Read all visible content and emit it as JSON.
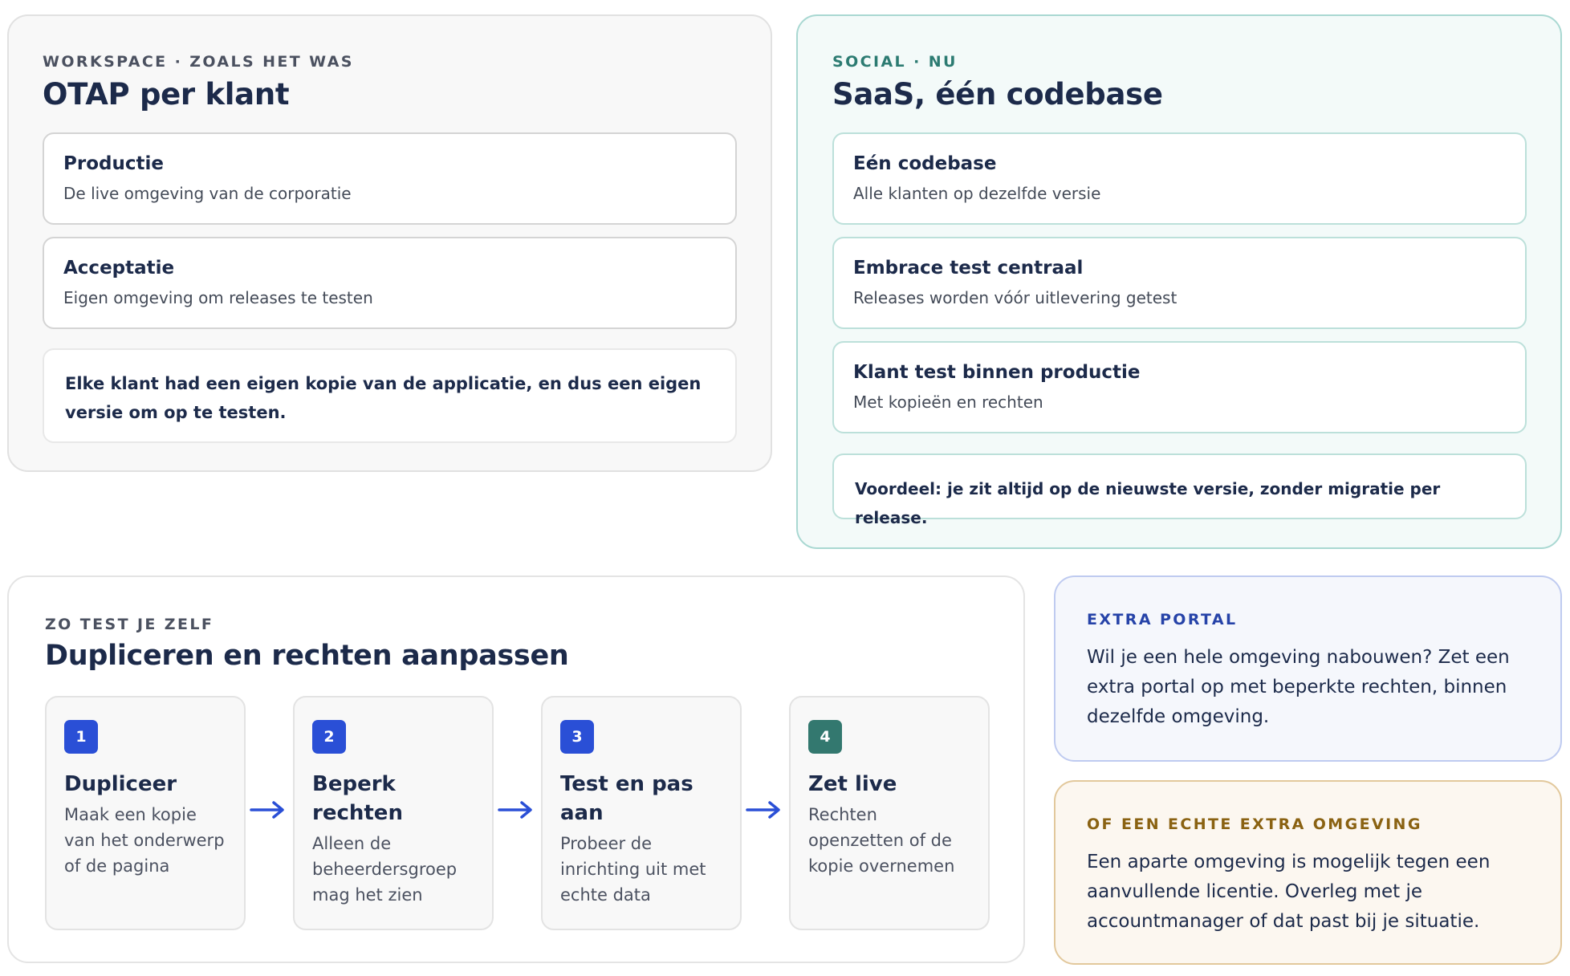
{
  "workspace": {
    "eyebrow": "WORKSPACE · ZOALS HET WAS",
    "title": "OTAP per klant",
    "cards": [
      {
        "title": "Productie",
        "desc": "De live omgeving van de corporatie"
      },
      {
        "title": "Acceptatie",
        "desc": "Eigen omgeving om releases te testen"
      }
    ],
    "note": "Elke klant had een eigen kopie van de applicatie, en dus een eigen versie om op te testen."
  },
  "social": {
    "eyebrow": "SOCIAL · NU",
    "title": "SaaS, één codebase",
    "cards": [
      {
        "title": "Eén codebase",
        "desc": "Alle klanten op dezelfde versie"
      },
      {
        "title": "Embrace test centraal",
        "desc": "Releases worden vóór uitlevering getest"
      },
      {
        "title": "Klant test binnen productie",
        "desc": "Met kopieën en rechten"
      }
    ],
    "note": "Voordeel: je zit altijd op de nieuwste versie, zonder migratie per release."
  },
  "steps": {
    "eyebrow": "ZO TEST JE ZELF",
    "title": "Dupliceren en rechten aanpassen",
    "items": [
      {
        "num": "1",
        "title": "Dupliceer",
        "desc": "Maak een kopie van het onderwerp of de pagina"
      },
      {
        "num": "2",
        "title": "Beperk rechten",
        "desc": "Alleen de beheerdersgroep mag het zien"
      },
      {
        "num": "3",
        "title": "Test en pas aan",
        "desc": "Probeer de inrichting uit met echte data"
      },
      {
        "num": "4",
        "title": "Zet live",
        "desc": "Rechten openzetten of de kopie overnemen"
      }
    ]
  },
  "portal": {
    "eyebrow": "EXTRA PORTAL",
    "text": "Wil je een hele omgeving nabouwen? Zet een extra portal op met beperkte rechten, binnen dezelfde omgeving."
  },
  "omgeving": {
    "eyebrow": "OF EEN ECHTE EXTRA OMGEVING",
    "text": "Een aparte omgeving is mogelijk tegen een aanvullende licentie. Overleg met je accountmanager of dat past bij je situatie."
  },
  "colors": {
    "step_blue": "#2a4fd6",
    "step_teal": "#33786f",
    "arrow": "#2a4fd6"
  }
}
